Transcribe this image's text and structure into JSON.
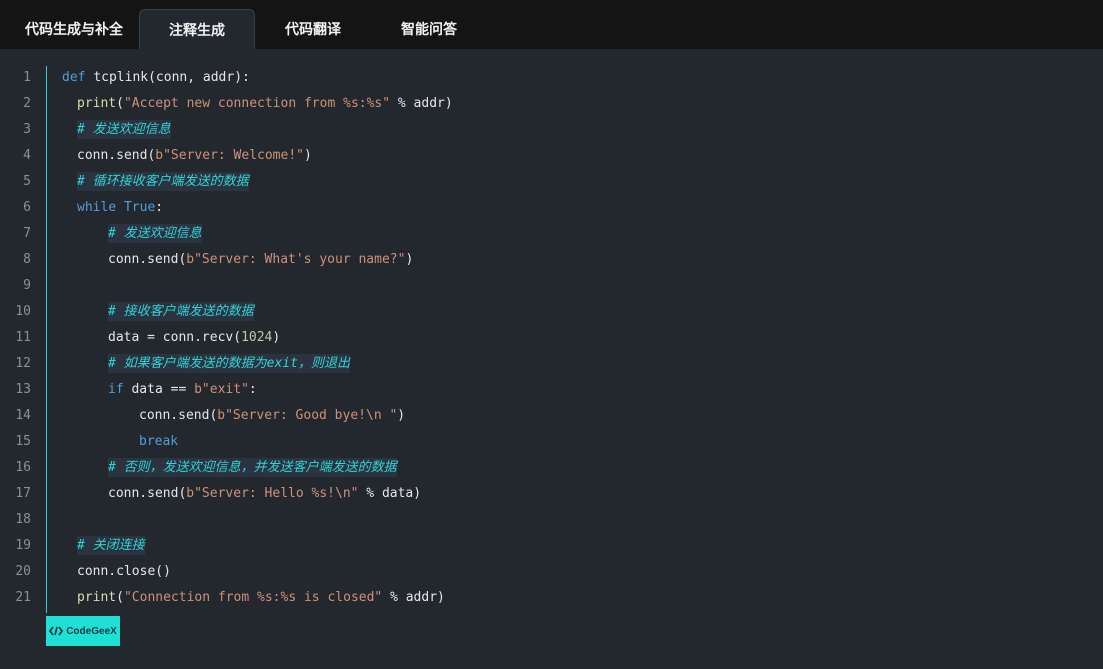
{
  "tabs": [
    {
      "label": "代码生成与补全",
      "active": false
    },
    {
      "label": "注释生成",
      "active": true
    },
    {
      "label": "代码翻译",
      "active": false
    },
    {
      "label": "智能问答",
      "active": false
    }
  ],
  "lines": [
    {
      "n": "1",
      "indent": 0,
      "parts": [
        {
          "c": "kw",
          "t": "def "
        },
        {
          "c": "txt",
          "t": "tcplink(conn, addr):"
        }
      ]
    },
    {
      "n": "2",
      "indent": 1,
      "parts": [
        {
          "c": "fn",
          "t": "print"
        },
        {
          "c": "txt",
          "t": "("
        },
        {
          "c": "str",
          "t": "\"Accept new connection from %s:%s\""
        },
        {
          "c": "txt",
          "t": " % addr)"
        }
      ]
    },
    {
      "n": "3",
      "indent": 1,
      "parts": [
        {
          "c": "cmt",
          "t": "# 发送欢迎信息"
        }
      ]
    },
    {
      "n": "4",
      "indent": 1,
      "parts": [
        {
          "c": "txt",
          "t": "conn.send("
        },
        {
          "c": "str",
          "t": "b\"Server: Welcome!\""
        },
        {
          "c": "txt",
          "t": ")"
        }
      ]
    },
    {
      "n": "5",
      "indent": 1,
      "parts": [
        {
          "c": "cmt",
          "t": "# 循环接收客户端发送的数据"
        }
      ]
    },
    {
      "n": "6",
      "indent": 1,
      "parts": [
        {
          "c": "kw",
          "t": "while "
        },
        {
          "c": "kw",
          "t": "True"
        },
        {
          "c": "txt",
          "t": ":"
        }
      ]
    },
    {
      "n": "7",
      "indent": 2,
      "parts": [
        {
          "c": "cmt",
          "t": "# 发送欢迎信息"
        }
      ]
    },
    {
      "n": "8",
      "indent": 2,
      "parts": [
        {
          "c": "txt",
          "t": "conn.send("
        },
        {
          "c": "str",
          "t": "b\"Server: What's your name?\""
        },
        {
          "c": "txt",
          "t": ")"
        }
      ]
    },
    {
      "n": "9",
      "indent": 2,
      "parts": []
    },
    {
      "n": "10",
      "indent": 2,
      "parts": [
        {
          "c": "cmt",
          "t": "# 接收客户端发送的数据"
        }
      ]
    },
    {
      "n": "11",
      "indent": 2,
      "parts": [
        {
          "c": "txt",
          "t": "data = conn.recv("
        },
        {
          "c": "num-lit",
          "t": "1024"
        },
        {
          "c": "txt",
          "t": ")"
        }
      ]
    },
    {
      "n": "12",
      "indent": 2,
      "parts": [
        {
          "c": "cmt",
          "t": "# 如果客户端发送的数据为exit，则退出"
        }
      ]
    },
    {
      "n": "13",
      "indent": 2,
      "parts": [
        {
          "c": "kw",
          "t": "if "
        },
        {
          "c": "txt",
          "t": "data == "
        },
        {
          "c": "str",
          "t": "b\"exit\""
        },
        {
          "c": "txt",
          "t": ":"
        }
      ]
    },
    {
      "n": "14",
      "indent": 3,
      "parts": [
        {
          "c": "txt",
          "t": "conn.send("
        },
        {
          "c": "str",
          "t": "b\"Server: Good bye!\\n \""
        },
        {
          "c": "txt",
          "t": ")"
        }
      ]
    },
    {
      "n": "15",
      "indent": 3,
      "parts": [
        {
          "c": "kw",
          "t": "break"
        }
      ]
    },
    {
      "n": "16",
      "indent": 2,
      "parts": [
        {
          "c": "cmt",
          "t": "# 否则，发送欢迎信息，并发送客户端发送的数据"
        }
      ]
    },
    {
      "n": "17",
      "indent": 2,
      "parts": [
        {
          "c": "txt",
          "t": "conn.send("
        },
        {
          "c": "str",
          "t": "b\"Server: Hello %s!\\n\""
        },
        {
          "c": "txt",
          "t": " % data)"
        }
      ]
    },
    {
      "n": "18",
      "indent": 2,
      "parts": []
    },
    {
      "n": "19",
      "indent": 1,
      "parts": [
        {
          "c": "cmt",
          "t": "# 关闭连接"
        }
      ]
    },
    {
      "n": "20",
      "indent": 1,
      "parts": [
        {
          "c": "txt",
          "t": "conn.close()"
        }
      ]
    },
    {
      "n": "21",
      "indent": 1,
      "parts": [
        {
          "c": "fn",
          "t": "print"
        },
        {
          "c": "txt",
          "t": "("
        },
        {
          "c": "str",
          "t": "\"Connection from %s:%s is closed\""
        },
        {
          "c": "txt",
          "t": " % addr)"
        }
      ]
    }
  ],
  "badge": {
    "label": "CodeGeeX",
    "icon": "codegeex-logo-icon"
  }
}
